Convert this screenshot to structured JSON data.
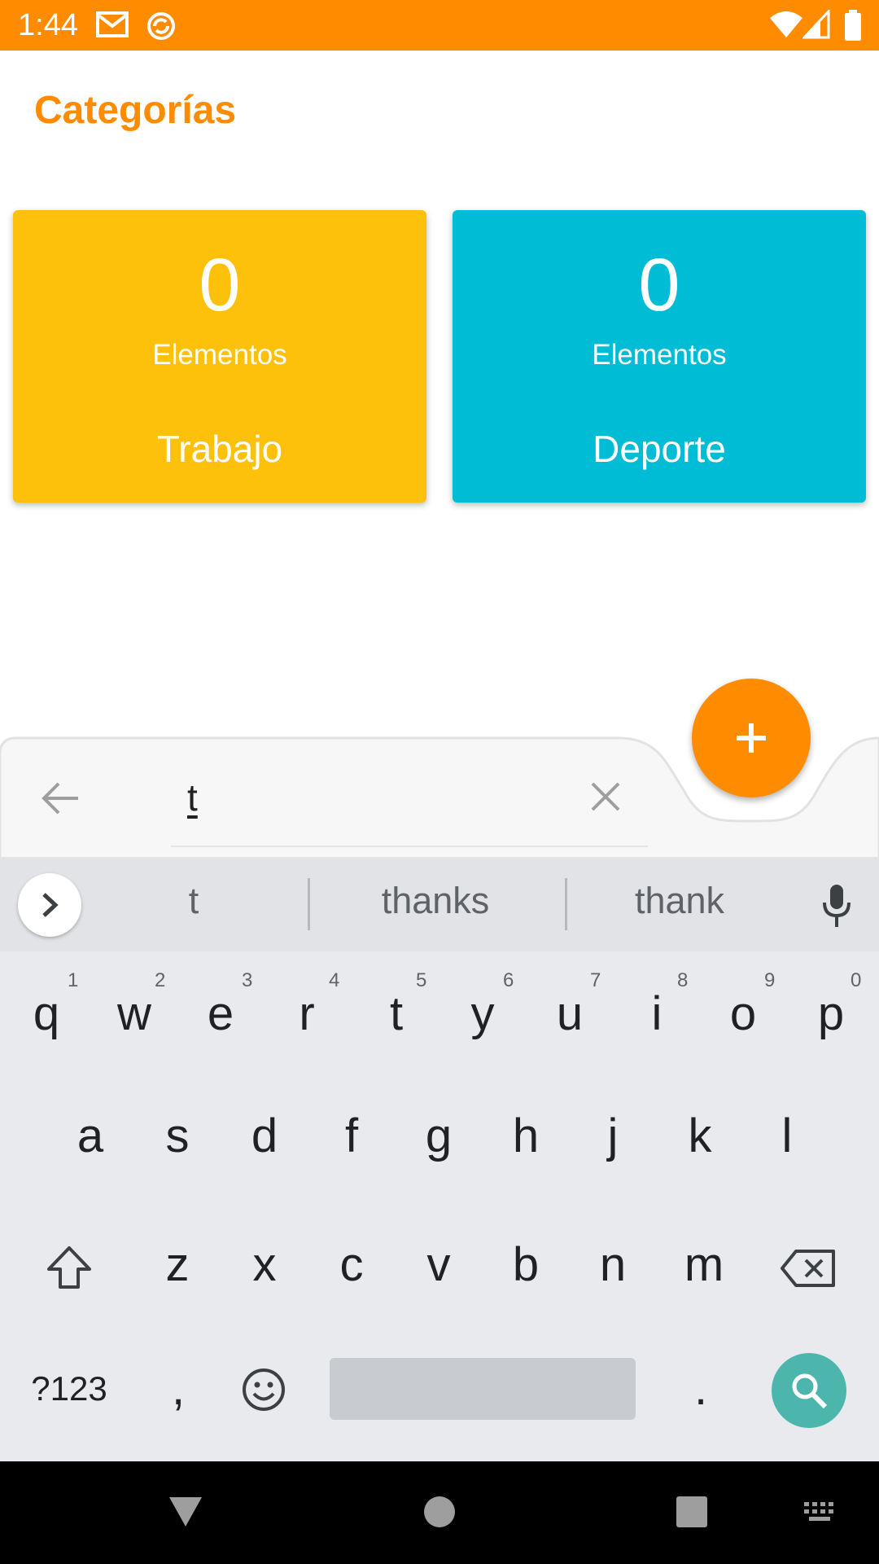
{
  "status_bar": {
    "time": "1:44",
    "icons": [
      "gmail-icon",
      "sync-icon",
      "wifi-icon",
      "signal-icon",
      "battery-icon"
    ],
    "background": "#FF8C00"
  },
  "header": {
    "title": "Categorías",
    "color": "#FF8C00"
  },
  "categories": [
    {
      "count": "0",
      "unit": "Elementos",
      "name": "Trabajo",
      "color": "#FDC00B"
    },
    {
      "count": "0",
      "unit": "Elementos",
      "name": "Deporte",
      "color": "#00BCD4"
    }
  ],
  "search": {
    "value": "t",
    "back_icon": "arrow-left-icon",
    "clear_icon": "close-icon"
  },
  "fab": {
    "icon": "plus-icon",
    "color": "#FF8C00"
  },
  "keyboard": {
    "suggestions": [
      "t",
      "thanks",
      "thank"
    ],
    "row1": [
      "q",
      "w",
      "e",
      "r",
      "t",
      "y",
      "u",
      "i",
      "o",
      "p"
    ],
    "row1_hints": [
      "1",
      "2",
      "3",
      "4",
      "5",
      "6",
      "7",
      "8",
      "9",
      "0"
    ],
    "row2": [
      "a",
      "s",
      "d",
      "f",
      "g",
      "h",
      "j",
      "k",
      "l"
    ],
    "row3": [
      "z",
      "x",
      "c",
      "v",
      "b",
      "n",
      "m"
    ],
    "symbols_label": "?123",
    "comma": ",",
    "period": ".",
    "action_color": "#4DB6AC"
  }
}
